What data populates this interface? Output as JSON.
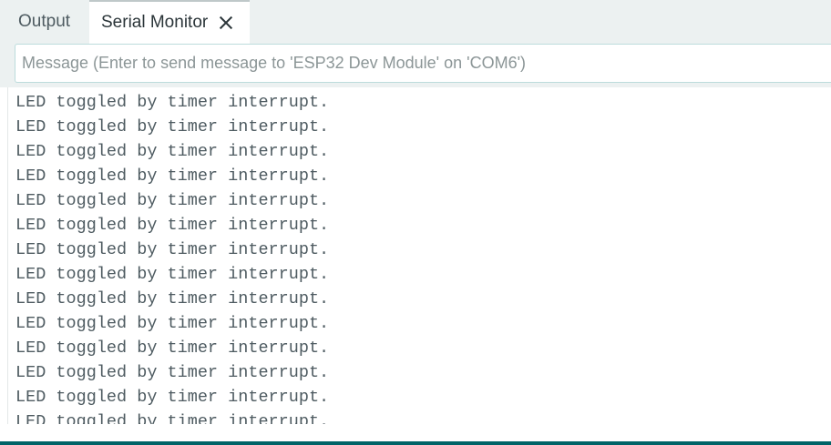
{
  "tabs": {
    "output_label": "Output",
    "serial_monitor_label": "Serial Monitor"
  },
  "message": {
    "placeholder": "Message (Enter to send message to 'ESP32 Dev Module' on 'COM6')",
    "value": ""
  },
  "console": {
    "lines": [
      "LED toggled by timer interrupt.",
      "LED toggled by timer interrupt.",
      "LED toggled by timer interrupt.",
      "LED toggled by timer interrupt.",
      "LED toggled by timer interrupt.",
      "LED toggled by timer interrupt.",
      "LED toggled by timer interrupt.",
      "LED toggled by timer interrupt.",
      "LED toggled by timer interrupt.",
      "LED toggled by timer interrupt.",
      "LED toggled by timer interrupt.",
      "LED toggled by timer interrupt.",
      "LED toggled by timer interrupt.",
      "LED toggled by timer interrupt."
    ]
  },
  "colors": {
    "panel_background": "#ecf1f1",
    "accent": "#006468",
    "console_text": "#4e5b61"
  }
}
